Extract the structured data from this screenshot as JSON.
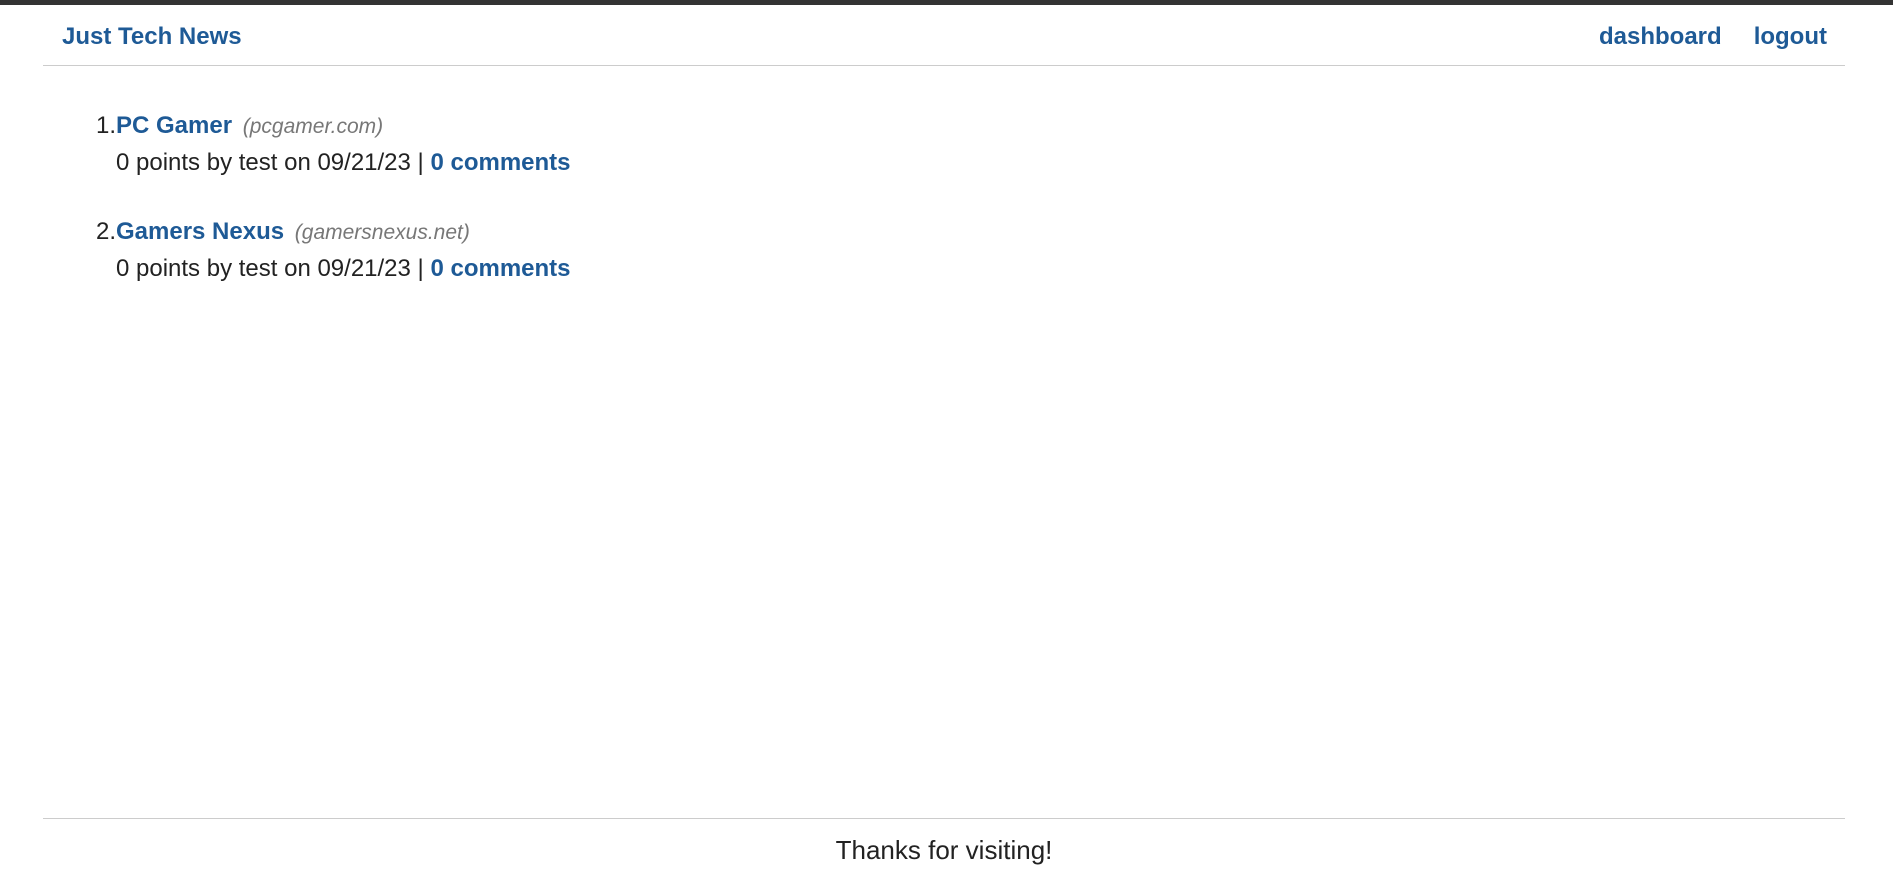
{
  "header": {
    "brand": "Just Tech News",
    "nav": {
      "dashboard": "dashboard",
      "logout": "logout"
    }
  },
  "posts": [
    {
      "number": "1.",
      "title": "PC Gamer",
      "host": "(pcgamer.com)",
      "meta": "0 points by test on 09/21/23 |",
      "comments": "0 comments"
    },
    {
      "number": "2.",
      "title": "Gamers Nexus",
      "host": "(gamersnexus.net)",
      "meta": "0 points by test on 09/21/23 |",
      "comments": "0 comments"
    }
  ],
  "footer": {
    "text": "Thanks for visiting!"
  },
  "colors": {
    "link": "#1e5a96",
    "topbar": "#333333",
    "divider": "#cccccc",
    "host": "#777777"
  }
}
